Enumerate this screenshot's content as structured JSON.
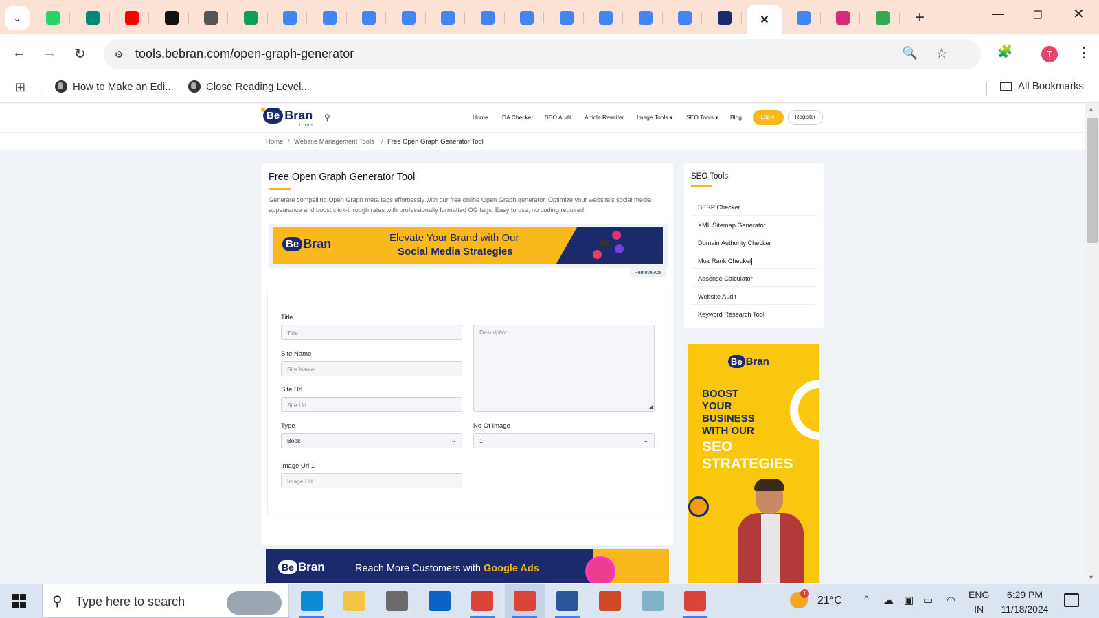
{
  "browser": {
    "tabs": [
      {
        "icon": "whatsapp-icon",
        "color": "#25d366"
      },
      {
        "icon": "google-meet-icon",
        "color": "#00897b"
      },
      {
        "icon": "youtube-icon",
        "color": "#ff0000"
      },
      {
        "icon": "chatgpt-icon",
        "color": "#111111"
      },
      {
        "icon": "chatgpt-icon",
        "color": "#555555"
      },
      {
        "icon": "google-sheets-icon",
        "color": "#0f9d58"
      },
      {
        "icon": "google-docs-icon",
        "color": "#4285f4"
      },
      {
        "icon": "google-docs-icon",
        "color": "#4285f4"
      },
      {
        "icon": "google-docs-icon",
        "color": "#4285f4"
      },
      {
        "icon": "google-docs-icon",
        "color": "#4285f4"
      },
      {
        "icon": "google-docs-icon",
        "color": "#4285f4"
      },
      {
        "icon": "google-docs-icon",
        "color": "#4285f4"
      },
      {
        "icon": "google-docs-icon",
        "color": "#4285f4"
      },
      {
        "icon": "google-docs-icon",
        "color": "#4285f4"
      },
      {
        "icon": "google-docs-icon",
        "color": "#4285f4"
      },
      {
        "icon": "google-docs-icon",
        "color": "#4285f4"
      },
      {
        "icon": "google-docs-icon",
        "color": "#4285f4"
      },
      {
        "icon": "bebran-icon",
        "color": "#1b2a6b"
      },
      {
        "icon": "close-icon",
        "color": "#222222",
        "active": true
      },
      {
        "icon": "google-icon",
        "color": "#4285f4"
      },
      {
        "icon": "instagram-icon",
        "color": "#d62976"
      },
      {
        "icon": "globe-icon",
        "color": "#34a853"
      }
    ],
    "url": "tools.bebran.com/open-graph-generator",
    "avatar_letter": "T",
    "bookmarks": [
      "How to Make an Edi...",
      "Close Reading Level..."
    ],
    "all_bookmarks": "All Bookmarks"
  },
  "site": {
    "nav": [
      "Home",
      "DA Checker",
      "SEO Audit",
      "Article Rewriter",
      "Image Tools",
      "SEO Tools",
      "Blog"
    ],
    "login": "Log in",
    "register": "Register",
    "breadcrumb": [
      "Home",
      "Website Management Tools",
      "Free Open Graph Generator Tool"
    ],
    "breadcrumb_sep": "/"
  },
  "main": {
    "title": "Free Open Graph Generator Tool",
    "intro": "Generate compelling Open Graph meta tags effortlessly with our free online Open Graph generator. Optimize your website's social media appearance and boost click-through rates with professionally formatted OG tags. Easy to use, no coding required!",
    "ad1": {
      "line1": "Elevate Your Brand with Our",
      "line2": "Social Media Strategies"
    },
    "remove_ads": "Remove Ads",
    "form": {
      "title_label": "Title",
      "title_placeholder": "Title",
      "site_name_label": "Site Name",
      "site_name_placeholder": "Site Name",
      "site_url_label": "Site Url",
      "site_url_placeholder": "Site Url",
      "description_placeholder": "Description",
      "type_label": "Type",
      "type_value": "Book",
      "no_image_label": "No Of Image",
      "no_image_value": "1",
      "image_url_label": "Image Url 1",
      "image_url_placeholder": "Image Url"
    },
    "ad2": {
      "text_plain": "Reach More Customers with ",
      "text_bold": "Google Ads"
    }
  },
  "sidebar": {
    "title": "SEO Tools",
    "items": [
      "SERP Checker",
      "XML Sitemap Generator",
      "Domain Authority Checker",
      "Moz Rank Checker",
      "Adsense Calculator",
      "Website Audit",
      "Keyword Research Tool"
    ],
    "ad": {
      "lines": [
        "BOOST",
        "YOUR",
        "BUSINESS",
        "WITH OUR"
      ],
      "white_lines": [
        "SEO",
        "STRATEGIES"
      ]
    }
  },
  "brand": {
    "be": "Be",
    "bran": "Bran",
    "sub": "TOOLS"
  },
  "taskbar": {
    "search_placeholder": "Type here to search",
    "apps": [
      {
        "icon": "edge-icon",
        "color": "#0c8ad6"
      },
      {
        "icon": "file-explorer-icon",
        "color": "#f4c542"
      },
      {
        "icon": "microsoft-store-icon",
        "color": "#6b6b6b"
      },
      {
        "icon": "outlook-icon",
        "color": "#0a64c5"
      },
      {
        "icon": "chrome-icon",
        "color": "#db4437"
      },
      {
        "icon": "chrome-profile-icon",
        "color": "#db4437"
      },
      {
        "icon": "word-icon",
        "color": "#2b579a"
      },
      {
        "icon": "powerpoint-icon",
        "color": "#d24726"
      },
      {
        "icon": "notepad-icon",
        "color": "#7fb3c8"
      },
      {
        "icon": "chrome-profile-icon",
        "color": "#db4437"
      }
    ],
    "weather_badge": "1",
    "temperature": "21°C",
    "lang1": "ENG",
    "lang2": "IN",
    "time": "6:29 PM",
    "date": "11/18/2024"
  }
}
